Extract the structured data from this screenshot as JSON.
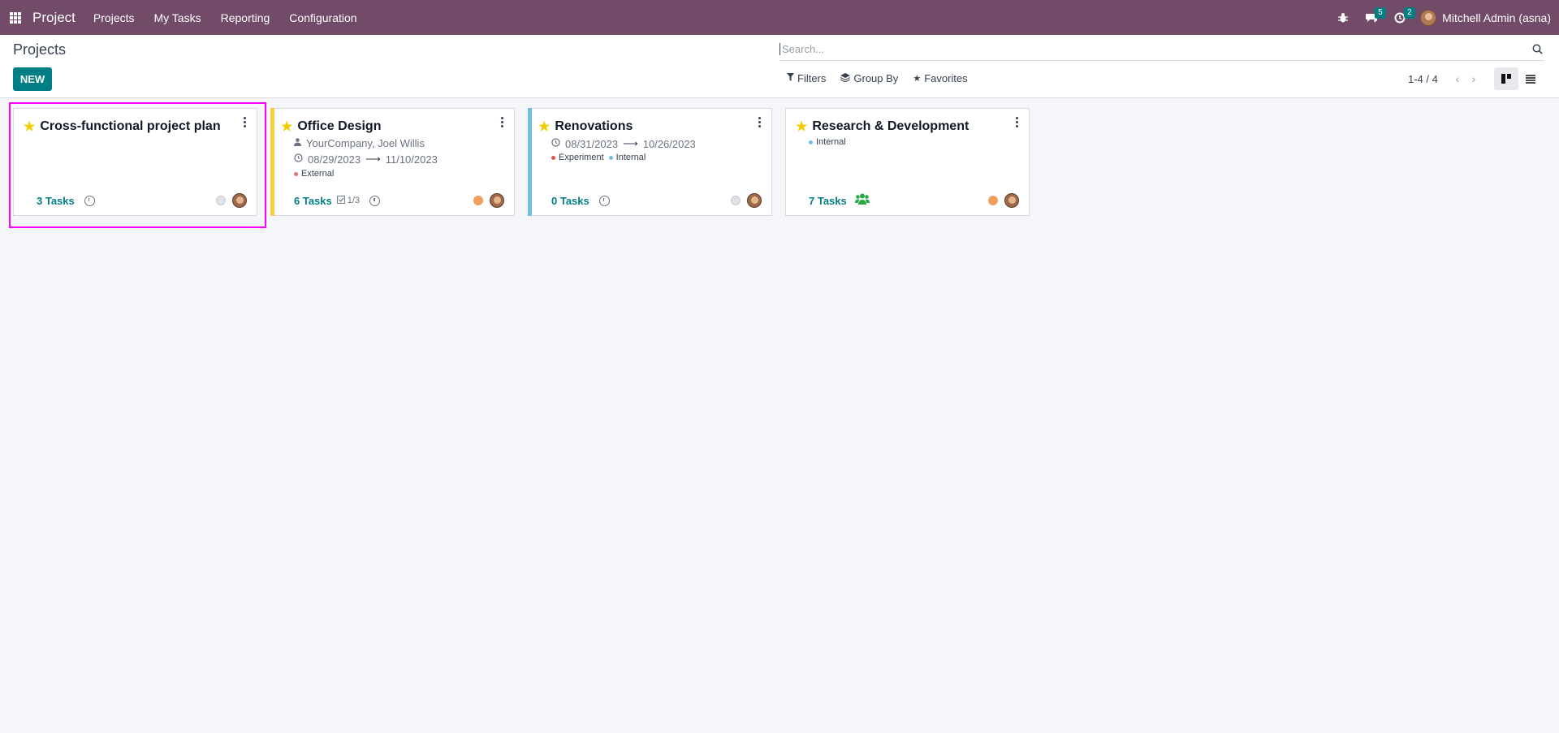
{
  "navbar": {
    "brand": "Project",
    "menu": [
      "Projects",
      "My Tasks",
      "Reporting",
      "Configuration"
    ],
    "messages_count": "5",
    "activities_count": "2",
    "user_name": "Mitchell Admin (asna)"
  },
  "control_panel": {
    "breadcrumb": "Projects",
    "new_label": "NEW",
    "search_placeholder": "Search...",
    "filters_label": "Filters",
    "groupby_label": "Group By",
    "favorites_label": "Favorites",
    "pager_value": "1-4 / 4"
  },
  "colors": {
    "navbar": "#714b67",
    "accent": "#017e84",
    "office_design_bar": "#f4d03f",
    "renovations_bar": "#6ec1e4",
    "status_grey": "#dee2e6",
    "status_orange": "#f0a05a"
  },
  "projects": [
    {
      "title": "Cross-functional project plan",
      "tasks": "3 Tasks",
      "status": "grey"
    },
    {
      "title": "Office Design",
      "customer": "YourCompany, Joel Willis",
      "date_start": "08/29/2023",
      "date_end": "11/10/2023",
      "tags": [
        {
          "name": "External",
          "color": "#e46f78"
        }
      ],
      "tasks": "6 Tasks",
      "milestones": "1/3",
      "status": "orange"
    },
    {
      "title": "Renovations",
      "date_start": "08/31/2023",
      "date_end": "10/26/2023",
      "tags": [
        {
          "name": "Experiment",
          "color": "#e0544c"
        },
        {
          "name": "Internal",
          "color": "#6ec1e4"
        }
      ],
      "tasks": "0 Tasks",
      "status": "grey"
    },
    {
      "title": "Research & Development",
      "tags": [
        {
          "name": "Internal",
          "color": "#6ec1e4"
        }
      ],
      "tasks": "7 Tasks",
      "status": "orange"
    }
  ]
}
